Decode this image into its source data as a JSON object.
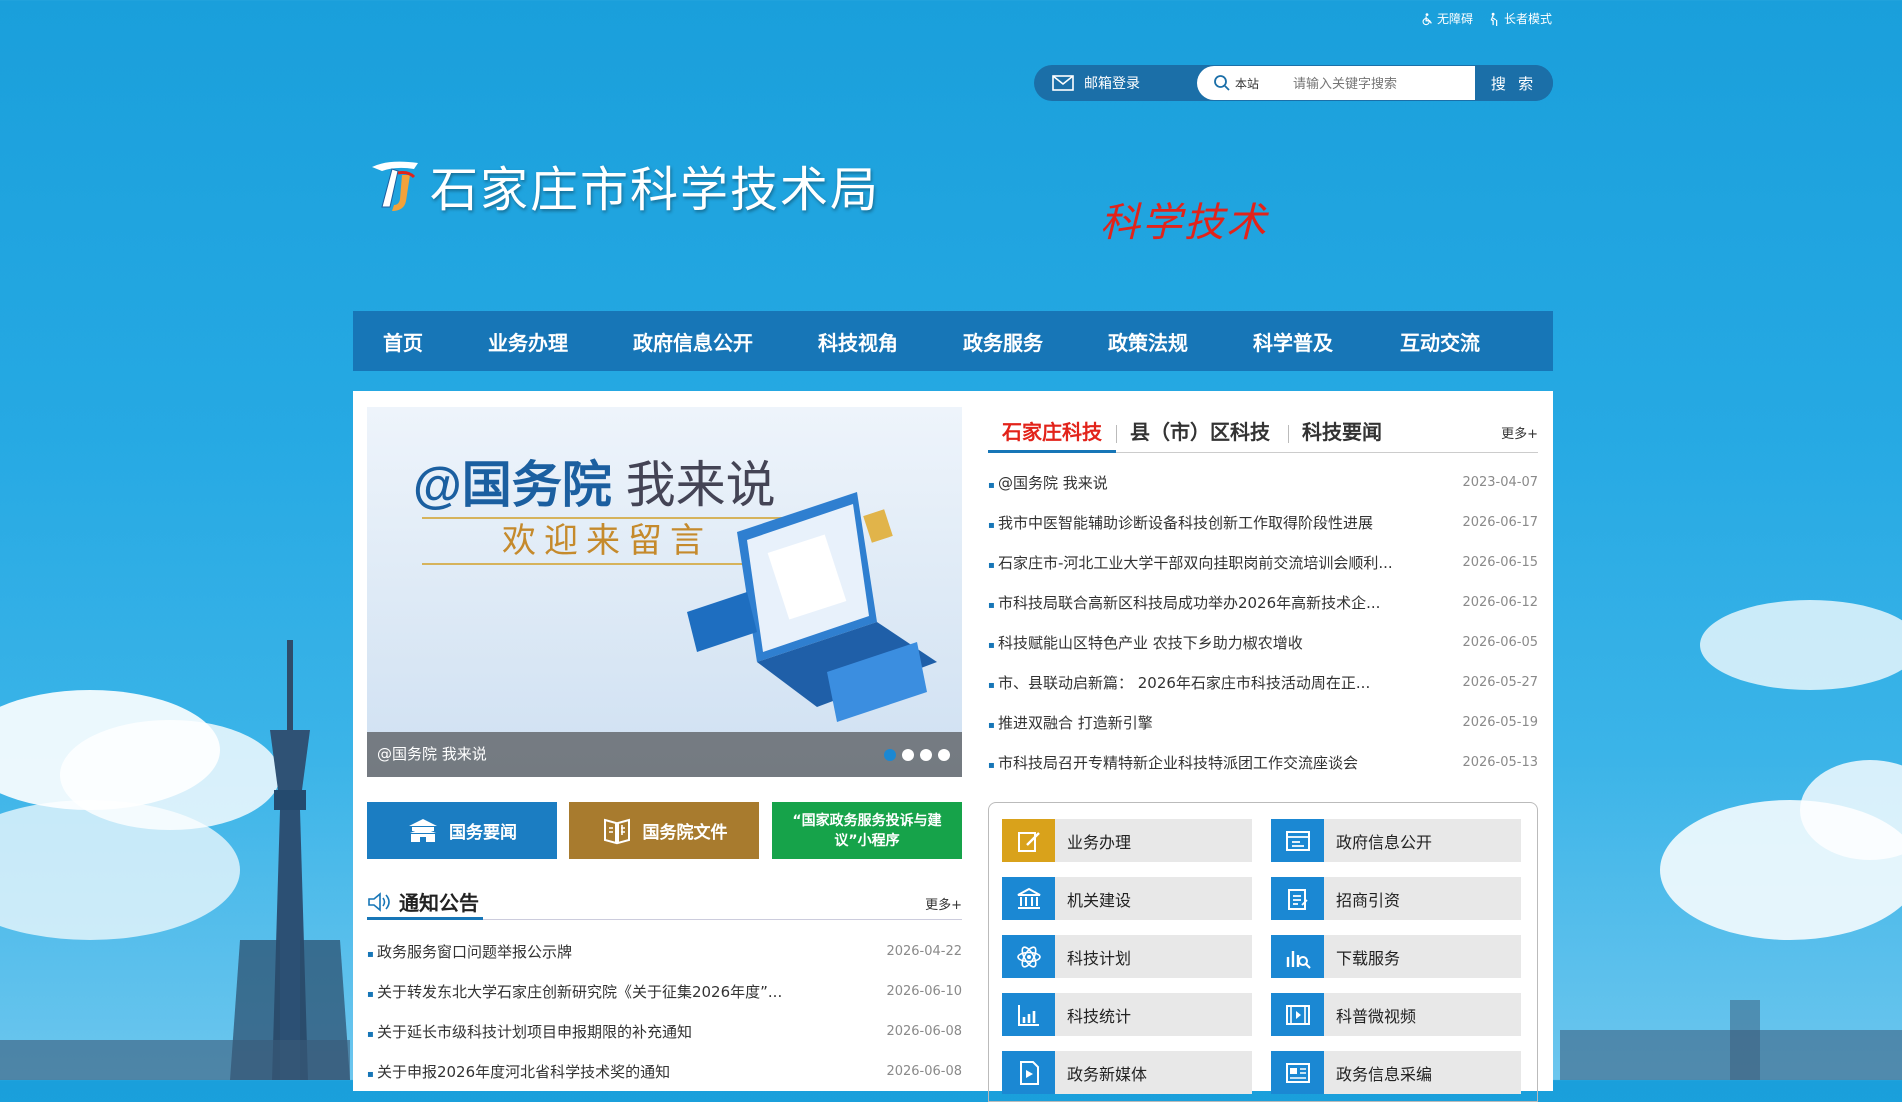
{
  "util": {
    "accessibility": "无障碍",
    "elder_mode": "长者模式"
  },
  "search": {
    "mail_label": "邮箱登录",
    "scope": "本站",
    "placeholder": "请输入关键字搜索",
    "button": "搜 索"
  },
  "header": {
    "site_title": "石家庄市科学技术局",
    "slogan": "科学技术"
  },
  "nav": [
    "首页",
    "业务办理",
    "政府信息公开",
    "科技视角",
    "政务服务",
    "政策法规",
    "科学普及",
    "互动交流"
  ],
  "slider": {
    "headline_a": "@国务院",
    "headline_b": "我来说",
    "subtitle": "欢迎来留言",
    "caption": "@国务院 我来说",
    "dots": 4,
    "active_dot": 1
  },
  "quick_buttons": [
    {
      "label": "国务要闻",
      "color": "#1b7dc2"
    },
    {
      "label": "国务院文件",
      "color": "#a87b2e"
    },
    {
      "label": "“国家政务服务投诉与建议”小程序",
      "color": "#16a34a"
    }
  ],
  "notice": {
    "title": "通知公告",
    "more": "更多+",
    "items": [
      {
        "title": "政务服务窗口问题举报公示牌",
        "date": "2026-04-22"
      },
      {
        "title": "关于转发东北大学石家庄创新研究院《关于征集2026年度”...",
        "date": "2026-06-10"
      },
      {
        "title": "关于延长市级科技计划项目申报期限的补充通知",
        "date": "2026-06-08"
      },
      {
        "title": "关于申报2026年度河北省科学技术奖的通知",
        "date": "2026-06-08"
      }
    ]
  },
  "news": {
    "tabs": [
      "石家庄科技",
      "县（市）区科技",
      "科技要闻"
    ],
    "active_tab": 0,
    "more": "更多+",
    "items": [
      {
        "title": "@国务院 我来说",
        "date": "2023-04-07"
      },
      {
        "title": "我市中医智能辅助诊断设备科技创新工作取得阶段性进展",
        "date": "2026-06-17"
      },
      {
        "title": "石家庄市-河北工业大学干部双向挂职岗前交流培训会顺利...",
        "date": "2026-06-15"
      },
      {
        "title": "市科技局联合高新区科技局成功举办2026年高新技术企...",
        "date": "2026-06-12"
      },
      {
        "title": "科技赋能山区特色产业 农技下乡助力椒农增收",
        "date": "2026-06-05"
      },
      {
        "title": "市、县联动启新篇： 2026年石家庄市科技活动周在正...",
        "date": "2026-05-27"
      },
      {
        "title": "推进双融合 打造新引擎",
        "date": "2026-05-19"
      },
      {
        "title": "市科技局召开专精特新企业科技特派团工作交流座谈会",
        "date": "2026-05-13"
      }
    ]
  },
  "services": [
    {
      "label": "业务办理",
      "icon": "edit-icon",
      "color": "#d9a21b"
    },
    {
      "label": "政府信息公开",
      "icon": "window-icon",
      "color": "#1b88d3"
    },
    {
      "label": "机关建设",
      "icon": "institution-icon",
      "color": "#1b88d3"
    },
    {
      "label": "招商引资",
      "icon": "clipboard-icon",
      "color": "#1b88d3"
    },
    {
      "label": "科技计划",
      "icon": "atom-icon",
      "color": "#1b88d3"
    },
    {
      "label": "下载服务",
      "icon": "chart-search-icon",
      "color": "#1b88d3"
    },
    {
      "label": "科技统计",
      "icon": "bar-chart-icon",
      "color": "#1b88d3"
    },
    {
      "label": "科普微视频",
      "icon": "film-icon",
      "color": "#1b88d3"
    },
    {
      "label": "政务新媒体",
      "icon": "play-doc-icon",
      "color": "#1b88d3"
    },
    {
      "label": "政务信息采编",
      "icon": "news-icon",
      "color": "#1b88d3"
    }
  ]
}
